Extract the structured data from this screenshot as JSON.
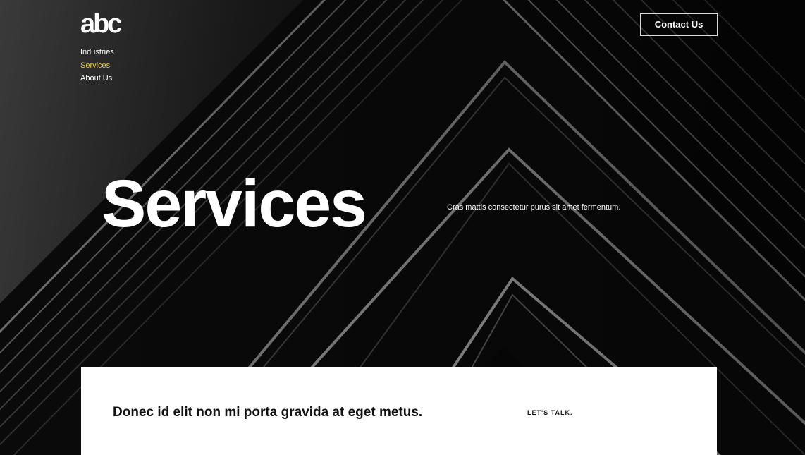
{
  "brand": {
    "logo_text": "abc"
  },
  "nav": {
    "items": [
      {
        "label": "Industries",
        "active": false
      },
      {
        "label": "Services",
        "active": true
      },
      {
        "label": "About Us",
        "active": false
      }
    ]
  },
  "header": {
    "contact_label": "Contact Us"
  },
  "hero": {
    "title": "Services",
    "subtitle": "Cras mattis consectetur purus sit amet fermentum."
  },
  "card": {
    "heading": "Donec id elit non mi porta gravida at eget metus.",
    "link_label": "LET'S TALK."
  },
  "colors": {
    "accent": "#e3c73f",
    "background": "#050505",
    "card": "#ffffff"
  }
}
